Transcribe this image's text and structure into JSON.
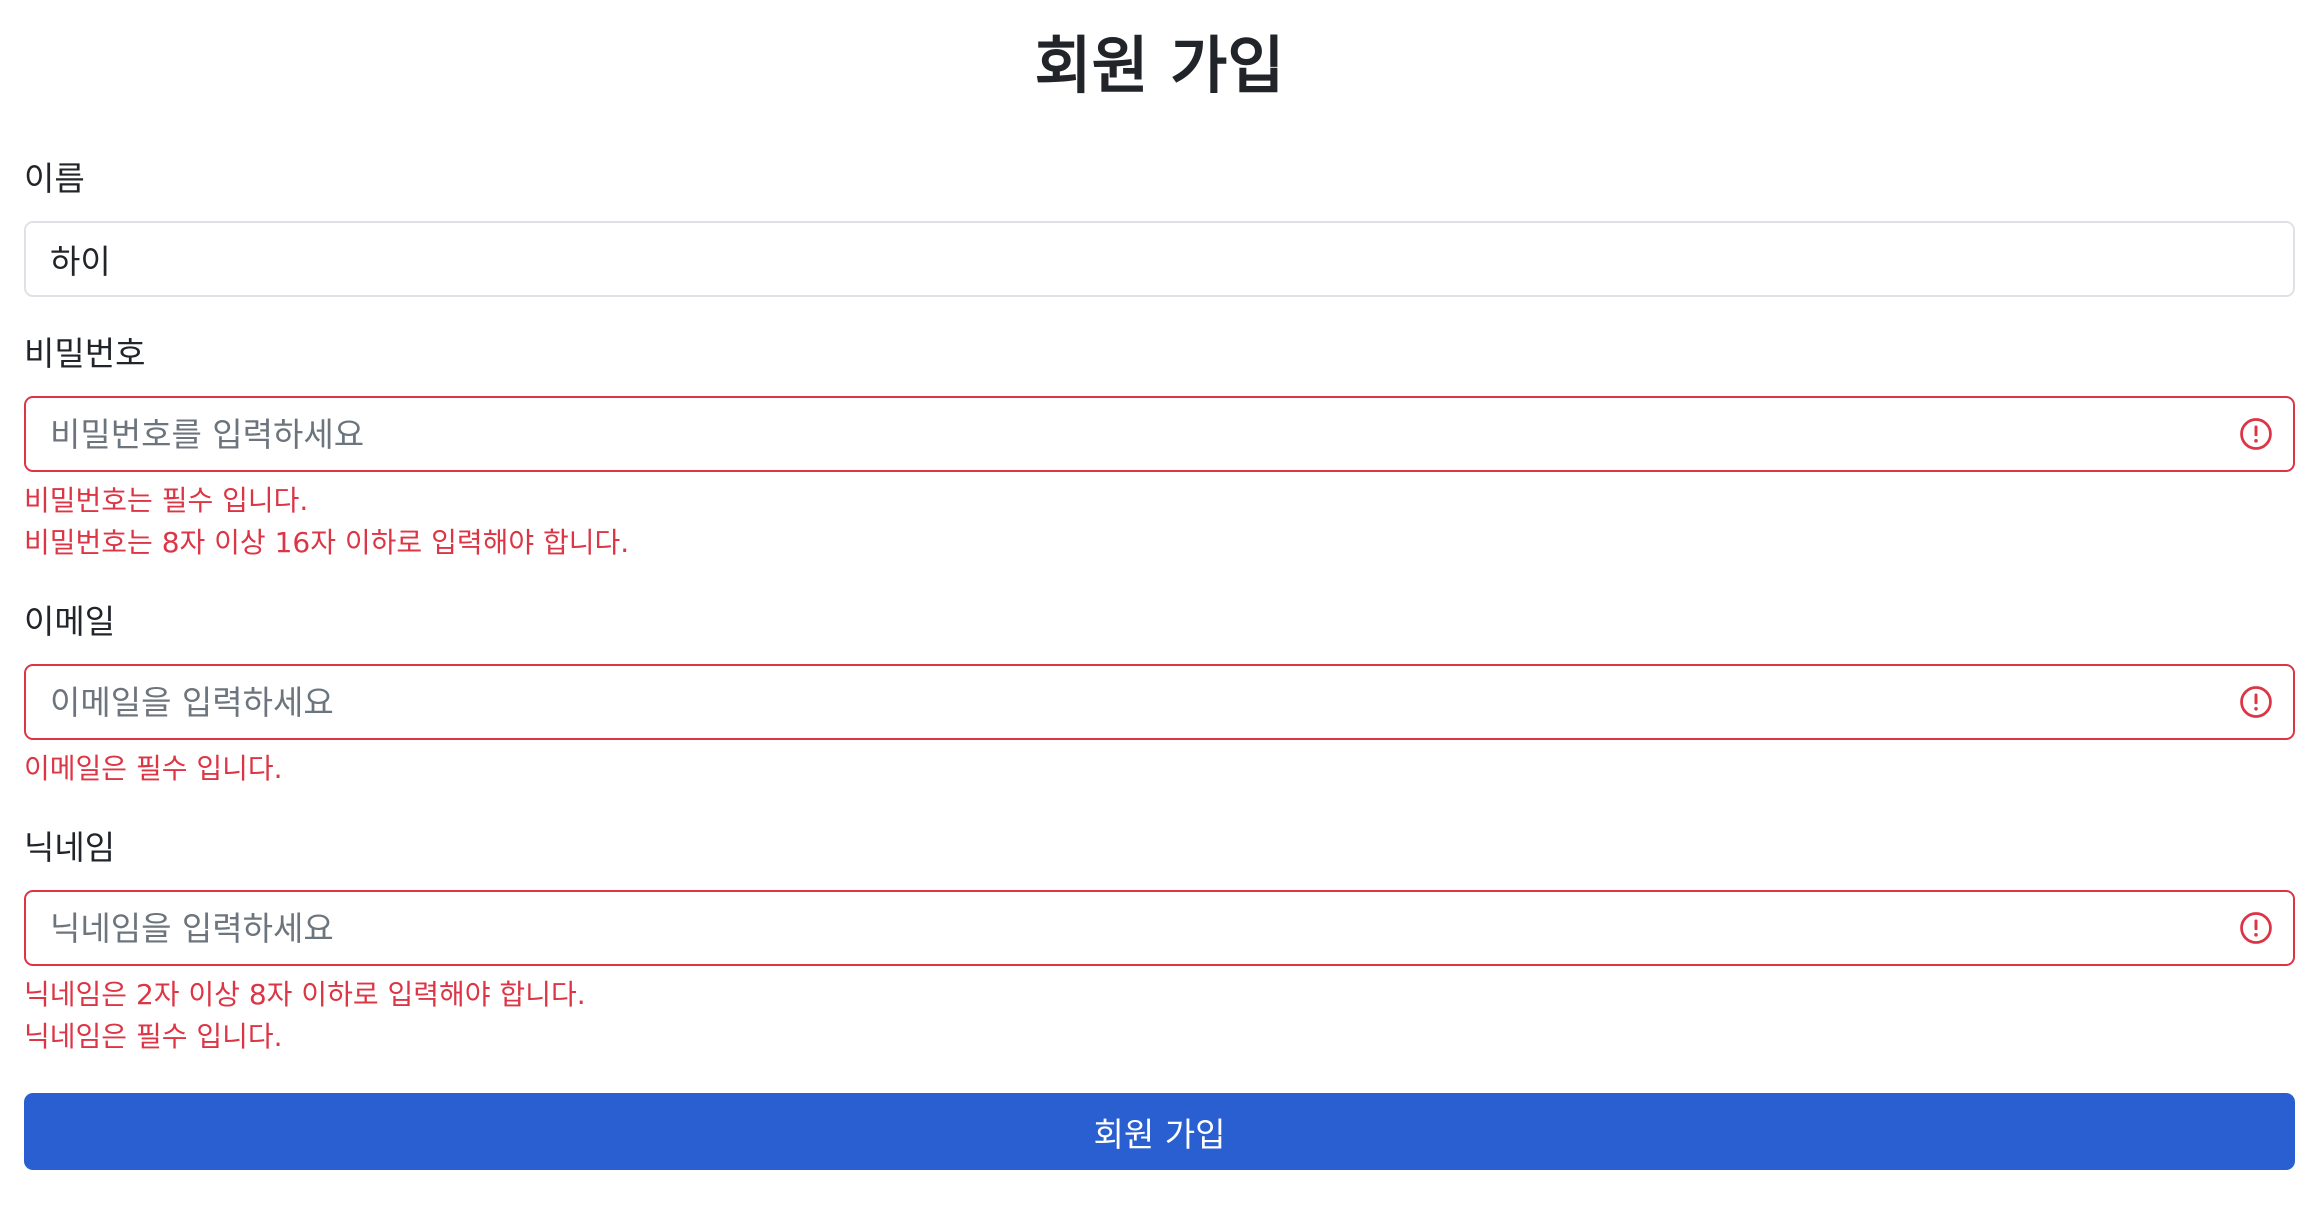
{
  "page": {
    "title": "회원 가입"
  },
  "fields": {
    "name": {
      "label": "이름",
      "value": "하이",
      "placeholder": ""
    },
    "password": {
      "label": "비밀번호",
      "value": "",
      "placeholder": "비밀번호를 입력하세요",
      "errors": [
        "비밀번호는 필수 입니다.",
        "비밀번호는 8자 이상 16자 이하로 입력해야 합니다."
      ]
    },
    "email": {
      "label": "이메일",
      "value": "",
      "placeholder": "이메일을 입력하세요",
      "errors": [
        "이메일은 필수 입니다."
      ]
    },
    "nickname": {
      "label": "닉네임",
      "value": "",
      "placeholder": "닉네임을 입력하세요",
      "errors": [
        "닉네임은 2자 이상 8자 이하로 입력해야 합니다.",
        "닉네임은 필수 입니다."
      ]
    }
  },
  "submit": {
    "label": "회원 가입"
  },
  "colors": {
    "error": "#dc3545",
    "primary": "#2a5fd2",
    "input_border": "#dee2e6"
  },
  "icons": {
    "field_error": "exclamation-circle-icon"
  }
}
